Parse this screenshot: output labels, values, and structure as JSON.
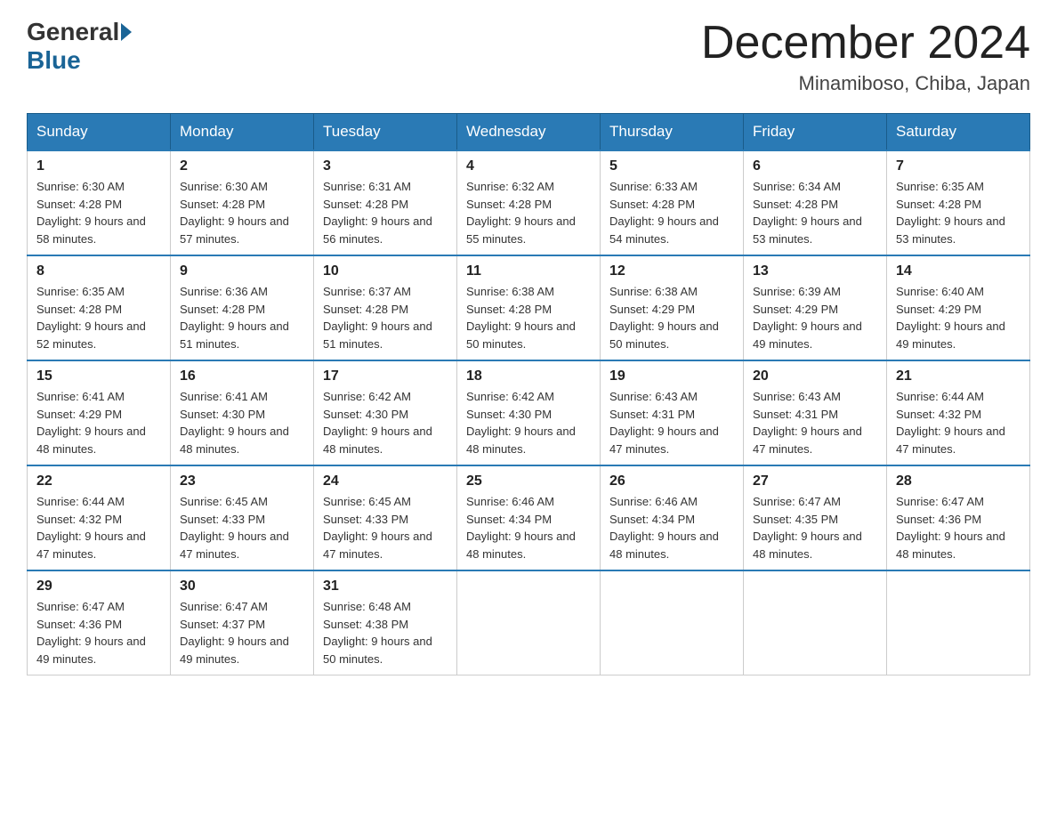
{
  "logo": {
    "general": "General",
    "blue": "Blue"
  },
  "title": "December 2024",
  "location": "Minamiboso, Chiba, Japan",
  "headers": [
    "Sunday",
    "Monday",
    "Tuesday",
    "Wednesday",
    "Thursday",
    "Friday",
    "Saturday"
  ],
  "weeks": [
    [
      {
        "day": "1",
        "sunrise": "6:30 AM",
        "sunset": "4:28 PM",
        "daylight": "9 hours and 58 minutes."
      },
      {
        "day": "2",
        "sunrise": "6:30 AM",
        "sunset": "4:28 PM",
        "daylight": "9 hours and 57 minutes."
      },
      {
        "day": "3",
        "sunrise": "6:31 AM",
        "sunset": "4:28 PM",
        "daylight": "9 hours and 56 minutes."
      },
      {
        "day": "4",
        "sunrise": "6:32 AM",
        "sunset": "4:28 PM",
        "daylight": "9 hours and 55 minutes."
      },
      {
        "day": "5",
        "sunrise": "6:33 AM",
        "sunset": "4:28 PM",
        "daylight": "9 hours and 54 minutes."
      },
      {
        "day": "6",
        "sunrise": "6:34 AM",
        "sunset": "4:28 PM",
        "daylight": "9 hours and 53 minutes."
      },
      {
        "day": "7",
        "sunrise": "6:35 AM",
        "sunset": "4:28 PM",
        "daylight": "9 hours and 53 minutes."
      }
    ],
    [
      {
        "day": "8",
        "sunrise": "6:35 AM",
        "sunset": "4:28 PM",
        "daylight": "9 hours and 52 minutes."
      },
      {
        "day": "9",
        "sunrise": "6:36 AM",
        "sunset": "4:28 PM",
        "daylight": "9 hours and 51 minutes."
      },
      {
        "day": "10",
        "sunrise": "6:37 AM",
        "sunset": "4:28 PM",
        "daylight": "9 hours and 51 minutes."
      },
      {
        "day": "11",
        "sunrise": "6:38 AM",
        "sunset": "4:28 PM",
        "daylight": "9 hours and 50 minutes."
      },
      {
        "day": "12",
        "sunrise": "6:38 AM",
        "sunset": "4:29 PM",
        "daylight": "9 hours and 50 minutes."
      },
      {
        "day": "13",
        "sunrise": "6:39 AM",
        "sunset": "4:29 PM",
        "daylight": "9 hours and 49 minutes."
      },
      {
        "day": "14",
        "sunrise": "6:40 AM",
        "sunset": "4:29 PM",
        "daylight": "9 hours and 49 minutes."
      }
    ],
    [
      {
        "day": "15",
        "sunrise": "6:41 AM",
        "sunset": "4:29 PM",
        "daylight": "9 hours and 48 minutes."
      },
      {
        "day": "16",
        "sunrise": "6:41 AM",
        "sunset": "4:30 PM",
        "daylight": "9 hours and 48 minutes."
      },
      {
        "day": "17",
        "sunrise": "6:42 AM",
        "sunset": "4:30 PM",
        "daylight": "9 hours and 48 minutes."
      },
      {
        "day": "18",
        "sunrise": "6:42 AM",
        "sunset": "4:30 PM",
        "daylight": "9 hours and 48 minutes."
      },
      {
        "day": "19",
        "sunrise": "6:43 AM",
        "sunset": "4:31 PM",
        "daylight": "9 hours and 47 minutes."
      },
      {
        "day": "20",
        "sunrise": "6:43 AM",
        "sunset": "4:31 PM",
        "daylight": "9 hours and 47 minutes."
      },
      {
        "day": "21",
        "sunrise": "6:44 AM",
        "sunset": "4:32 PM",
        "daylight": "9 hours and 47 minutes."
      }
    ],
    [
      {
        "day": "22",
        "sunrise": "6:44 AM",
        "sunset": "4:32 PM",
        "daylight": "9 hours and 47 minutes."
      },
      {
        "day": "23",
        "sunrise": "6:45 AM",
        "sunset": "4:33 PM",
        "daylight": "9 hours and 47 minutes."
      },
      {
        "day": "24",
        "sunrise": "6:45 AM",
        "sunset": "4:33 PM",
        "daylight": "9 hours and 47 minutes."
      },
      {
        "day": "25",
        "sunrise": "6:46 AM",
        "sunset": "4:34 PM",
        "daylight": "9 hours and 48 minutes."
      },
      {
        "day": "26",
        "sunrise": "6:46 AM",
        "sunset": "4:34 PM",
        "daylight": "9 hours and 48 minutes."
      },
      {
        "day": "27",
        "sunrise": "6:47 AM",
        "sunset": "4:35 PM",
        "daylight": "9 hours and 48 minutes."
      },
      {
        "day": "28",
        "sunrise": "6:47 AM",
        "sunset": "4:36 PM",
        "daylight": "9 hours and 48 minutes."
      }
    ],
    [
      {
        "day": "29",
        "sunrise": "6:47 AM",
        "sunset": "4:36 PM",
        "daylight": "9 hours and 49 minutes."
      },
      {
        "day": "30",
        "sunrise": "6:47 AM",
        "sunset": "4:37 PM",
        "daylight": "9 hours and 49 minutes."
      },
      {
        "day": "31",
        "sunrise": "6:48 AM",
        "sunset": "4:38 PM",
        "daylight": "9 hours and 50 minutes."
      },
      null,
      null,
      null,
      null
    ]
  ]
}
